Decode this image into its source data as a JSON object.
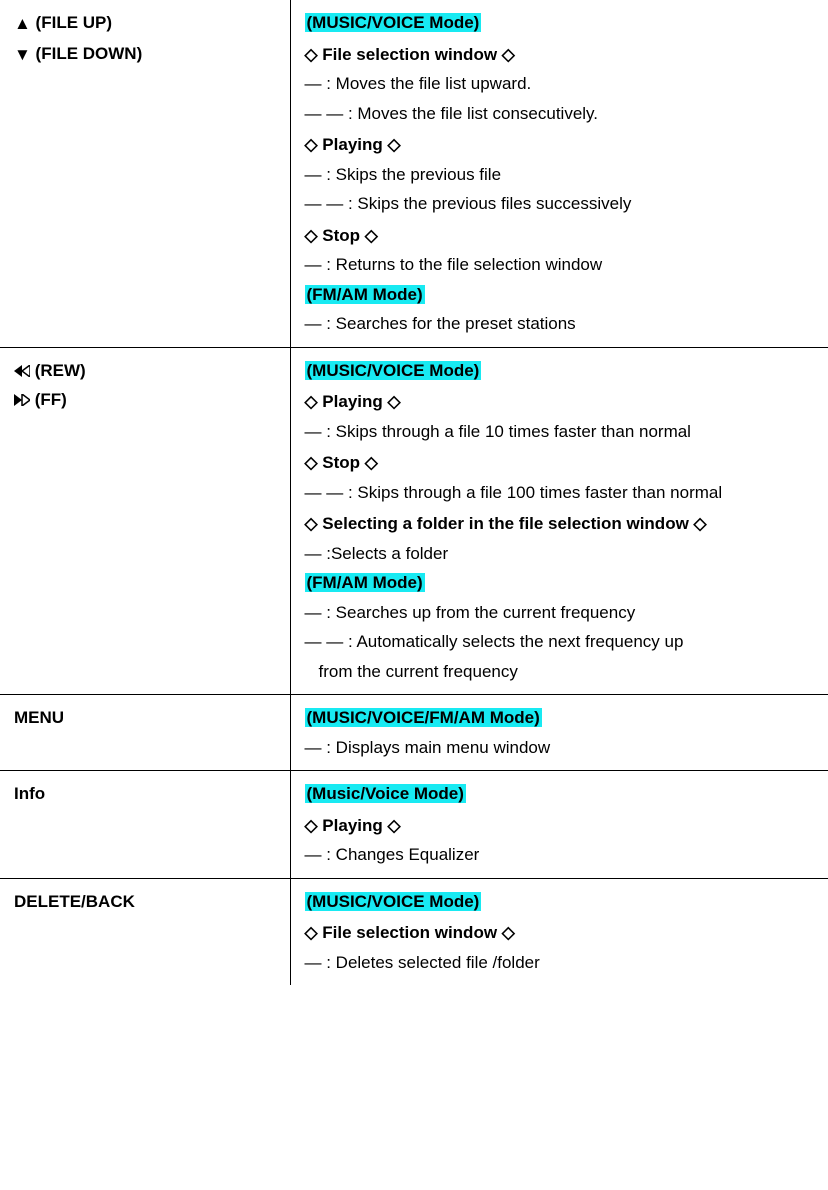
{
  "triUp": "▲",
  "triDown": "▼",
  "dash": "—",
  "diamond": "◇",
  "rows": [
    {
      "left": {
        "lines": [
          {
            "icon": "tri-up",
            "text": " (FILE UP)"
          },
          {
            "icon": "tri-down",
            "text": " (FILE DOWN)"
          }
        ]
      },
      "right": {
        "blocks": [
          {
            "type": "mode",
            "text": "(MUSIC/VOICE Mode)"
          },
          {
            "type": "section",
            "text": "File selection window"
          },
          {
            "type": "item",
            "dashes": 1,
            "text": ": Moves the file list upward."
          },
          {
            "type": "item",
            "dashes": 2,
            "nosp": true,
            "text": ": Moves the file list consecutively."
          },
          {
            "type": "section",
            "text": "Playing"
          },
          {
            "type": "item",
            "dashes": 1,
            "text": ": Skips the previous file"
          },
          {
            "type": "item",
            "dashes": 2,
            "text": ": Skips the previous files successively"
          },
          {
            "type": "section",
            "text": "Stop"
          },
          {
            "type": "item",
            "dashes": 1,
            "text": ": Returns to the file selection window"
          },
          {
            "type": "mode",
            "text": "(FM/AM Mode)"
          },
          {
            "type": "item",
            "dashes": 1,
            "text": ": Searches for the preset stations"
          }
        ]
      }
    },
    {
      "left": {
        "lines": [
          {
            "icon": "rew",
            "text": " (REW)"
          },
          {
            "icon": "ff",
            "text": "(FF)"
          }
        ]
      },
      "right": {
        "blocks": [
          {
            "type": "mode",
            "text": "(MUSIC/VOICE Mode)"
          },
          {
            "type": "section",
            "text": "Playing"
          },
          {
            "type": "item",
            "dashes": 1,
            "text": ": Skips through a file 10 times faster than normal"
          },
          {
            "type": "section",
            "text": "Stop"
          },
          {
            "type": "item",
            "dashes": 2,
            "just": true,
            "text": ": Skips through a file 100 times faster than normal"
          },
          {
            "type": "section",
            "text": "Selecting a folder in the file selection window"
          },
          {
            "type": "item",
            "dashes": 1,
            "nosp": true,
            "text": ":Selects a folder"
          },
          {
            "type": "mode",
            "text": "(FM/AM Mode)"
          },
          {
            "type": "item",
            "dashes": 1,
            "text": ": Searches up from the current frequency"
          },
          {
            "type": "item",
            "dashes": 2,
            "just": true,
            "text": ": Automatically selects the next frequency up",
            "cont": "from the current frequency"
          }
        ]
      }
    },
    {
      "left": {
        "lines": [
          {
            "text": "MENU"
          }
        ]
      },
      "right": {
        "blocks": [
          {
            "type": "mode",
            "text": "(MUSIC/VOICE/FM/AM Mode)"
          },
          {
            "type": "item",
            "dashes": 1,
            "text": ": Displays main menu window"
          }
        ]
      }
    },
    {
      "left": {
        "lines": [
          {
            "text": "Info"
          }
        ]
      },
      "right": {
        "blocks": [
          {
            "type": "mode",
            "pre": " ",
            "text": "(Music/Voice Mode)"
          },
          {
            "type": "section",
            "text": "Playing"
          },
          {
            "type": "item",
            "dashes": 1,
            "nosp": true,
            "text": ": Changes Equalizer"
          }
        ]
      }
    },
    {
      "left": {
        "lines": [
          {
            "text": "DELETE/BACK"
          }
        ]
      },
      "right": {
        "blocks": [
          {
            "type": "mode",
            "text": "(MUSIC/VOICE Mode)"
          },
          {
            "type": "section",
            "text": "File selection window"
          },
          {
            "type": "item",
            "dashes": 1,
            "text": ": Deletes selected file /folder"
          }
        ]
      }
    }
  ]
}
